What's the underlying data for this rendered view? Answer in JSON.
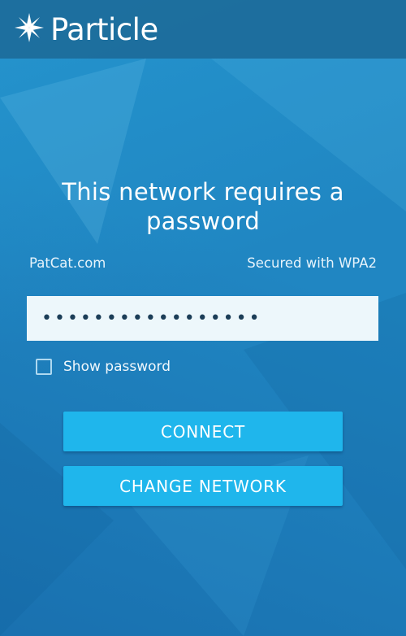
{
  "header": {
    "brand": "Particle",
    "logo_icon": "particle-star-logo-icon"
  },
  "main": {
    "title_line1": "This network requires a",
    "title_line2": "password",
    "network_name": "PatCat.com",
    "security": "Secured with WPA2",
    "password_value": "•••••••••••••••••",
    "show_password_label": "Show password",
    "show_password_checked": false,
    "connect_label": "CONNECT",
    "change_network_label": "CHANGE NETWORK"
  },
  "colors": {
    "background": "#2086c2",
    "topbar": "#1c6996",
    "button": "#1fb6ec",
    "input": "#edf7fb",
    "text": "#ffffff"
  }
}
